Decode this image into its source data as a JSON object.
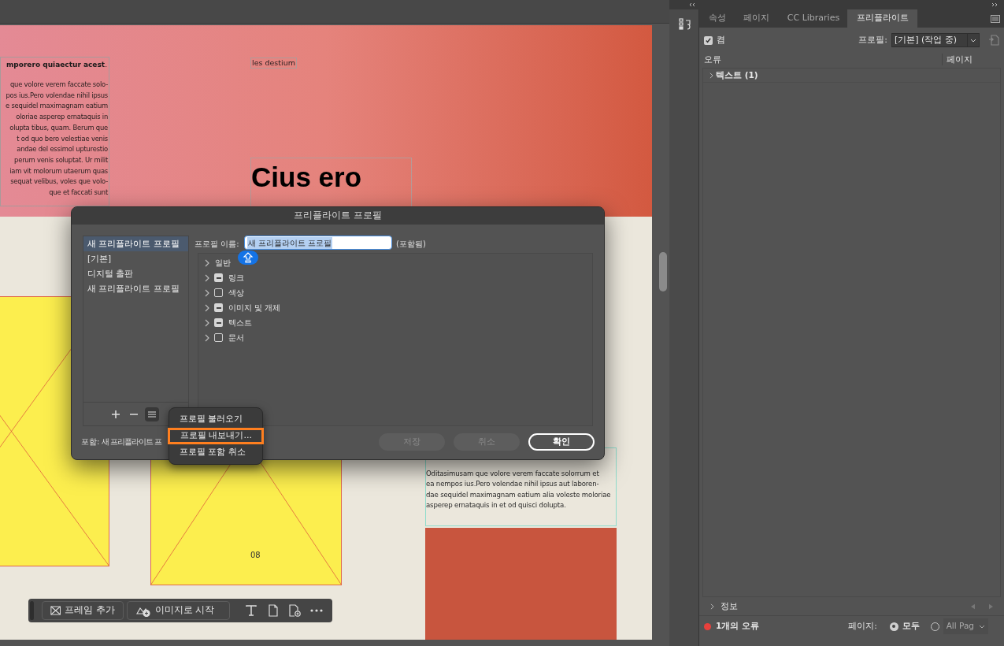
{
  "document": {
    "left_frame": {
      "heading": "**mporero quiaectur acest**.",
      "lines": [
        "que volore verem faccate solo-",
        "pos ius.Pero volendae nihil ipsus",
        "e sequidel maximagnam eatium",
        "oloriae asperep ernataquis in",
        "olupta tibus, quam. Berum que",
        "t od quo bero velestiae venis",
        "andae del essimol upturestio",
        "perum venis soluptat. Ur milit",
        "iam vit molorum utaerum quas",
        "sequat velibus, voles que volo-",
        "que et faccati sunt"
      ]
    },
    "caption": "les destium",
    "headline": "Cius ero",
    "page_number": "08",
    "right_frame": {
      "lines": [
        "Oditasimusam que volore verem faccate solorrum et",
        "ea nempos ius.Pero volendae nihil ipsus aut laboren-",
        "dae sequidel maximagnam eatium alia voleste moloriae",
        "asperep ernataquis in et od quisci dolupta."
      ]
    }
  },
  "toolbar": {
    "buttons": [
      "프레임 추가",
      "이미지로 시작"
    ]
  },
  "dialog": {
    "title": "프리플라이트 프로필",
    "profiles": [
      {
        "label": "새 프리플라이트 프로필",
        "selected": true
      },
      {
        "label": "[기본]",
        "selected": false
      },
      {
        "label": "디지털 출판",
        "selected": false
      },
      {
        "label": "새 프리플라이트 프로필",
        "selected": false
      }
    ],
    "name_label": "프로필 이름:",
    "name_value": "새 프리플라이트 프로필",
    "name_text_selected": true,
    "name_status": "(포함됨)",
    "categories": [
      {
        "label": "일반",
        "kind": "group"
      },
      {
        "label": "링크",
        "kind": "checkbox",
        "checked": true,
        "mixed": true
      },
      {
        "label": "색상",
        "kind": "checkbox",
        "checked": false,
        "mixed": false
      },
      {
        "label": "이미지 및 개체",
        "kind": "checkbox",
        "checked": true,
        "mixed": true
      },
      {
        "label": "텍스트",
        "kind": "checkbox",
        "checked": true,
        "mixed": true
      },
      {
        "label": "문서",
        "kind": "checkbox",
        "checked": false,
        "mixed": false
      }
    ],
    "embedded_label": "포함:",
    "embedded_value": "새 프리플라이트 프",
    "buttons": [
      {
        "label": "저장",
        "disabled": true,
        "kind": "normal"
      },
      {
        "label": "취소",
        "disabled": true,
        "kind": "normal"
      },
      {
        "label": "확인",
        "disabled": false,
        "kind": "primary"
      }
    ],
    "menu": [
      {
        "label": "프로필 불러오기",
        "highlighted": false
      },
      {
        "label": "프로필 내보내기...",
        "highlighted": true
      },
      {
        "label": "프로필 포함 취소",
        "highlighted": false
      }
    ]
  },
  "panel": {
    "tabs": [
      {
        "label": "속성",
        "selected": false
      },
      {
        "label": "페이지",
        "selected": false
      },
      {
        "label": "CC Libraries",
        "selected": false
      },
      {
        "label": "프리플라이트",
        "selected": true
      }
    ],
    "enabled": true,
    "enabled_label": "켬",
    "profile_label": "프로필:",
    "profile_value": "[기본] (작업 중)",
    "columns": [
      "오류",
      "페이지"
    ],
    "rows": [
      {
        "label": "텍스트 (1)",
        "expanded": false
      }
    ],
    "info_label": "정보",
    "info_expanded": false,
    "has_errors": true,
    "error_text": "1개의 오류",
    "pages_label": "페이지:",
    "page_options": [
      {
        "label": "모두",
        "selected": true
      },
      {
        "label": "All Pag",
        "selected": false
      }
    ]
  }
}
